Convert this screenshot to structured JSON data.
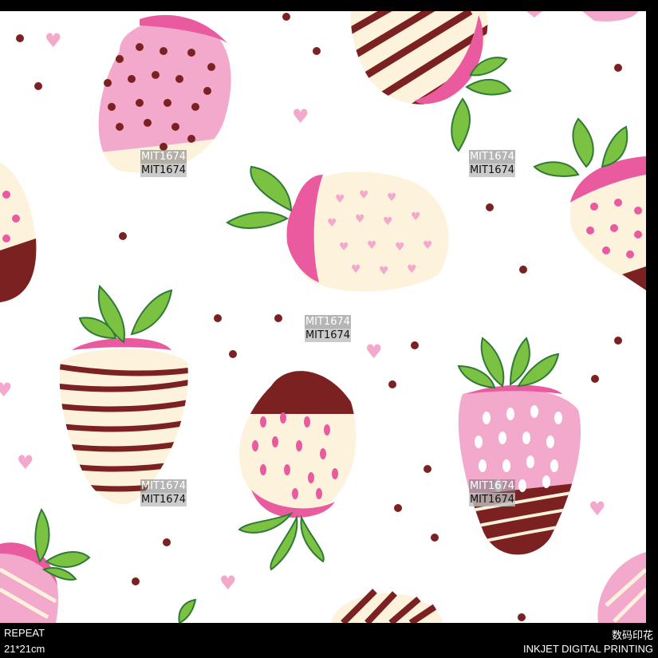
{
  "footer": {
    "left_top": "REPEAT",
    "left_bottom": "21*21cm",
    "right_top": "数码印花",
    "right_bottom": "INKJET DIGITAL PRINTING"
  },
  "watermark": "MIT1674",
  "colors": {
    "background": "#ffffff",
    "light_pink": "#f3a9cb",
    "hot_pink": "#e95a9e",
    "cream": "#fdf2dc",
    "chocolate": "#7c2122",
    "leaf_green": "#7cc242",
    "leaf_dark": "#2f7a36"
  }
}
